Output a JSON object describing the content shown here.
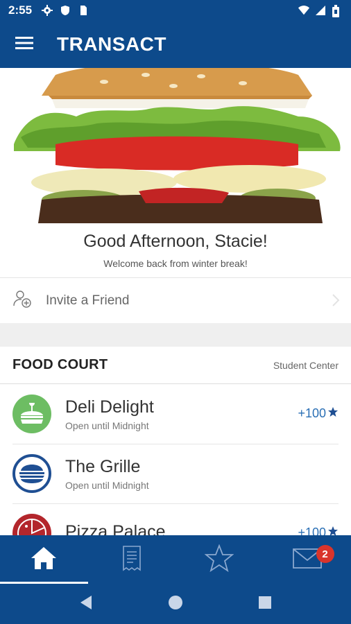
{
  "status_bar": {
    "time": "2:55"
  },
  "app_bar": {
    "title": "TRANSACT"
  },
  "hero": {
    "greeting": "Good Afternoon, Stacie!",
    "subtitle": "Welcome back from winter break!"
  },
  "invite": {
    "label": "Invite a Friend"
  },
  "section": {
    "title": "FOOD COURT",
    "location": "Student Center"
  },
  "restaurants": [
    {
      "name": "Deli Delight",
      "status": "Open until Midnight",
      "points": "+100",
      "logo_color": "#6dbd63",
      "icon": "sandwich-icon"
    },
    {
      "name": "The Grille",
      "status": "Open until Midnight",
      "points": "",
      "logo_color": "#1f4f93",
      "icon": "burger-icon"
    },
    {
      "name": "Pizza Palace",
      "status": "",
      "points": "+100",
      "logo_color": "#b3262c",
      "icon": "pizza-icon"
    }
  ],
  "bottom_nav": {
    "messages_badge": "2"
  },
  "colors": {
    "brand": "#0d4a8b",
    "accent_link": "#2a6fb5",
    "badge": "#d9342b"
  }
}
